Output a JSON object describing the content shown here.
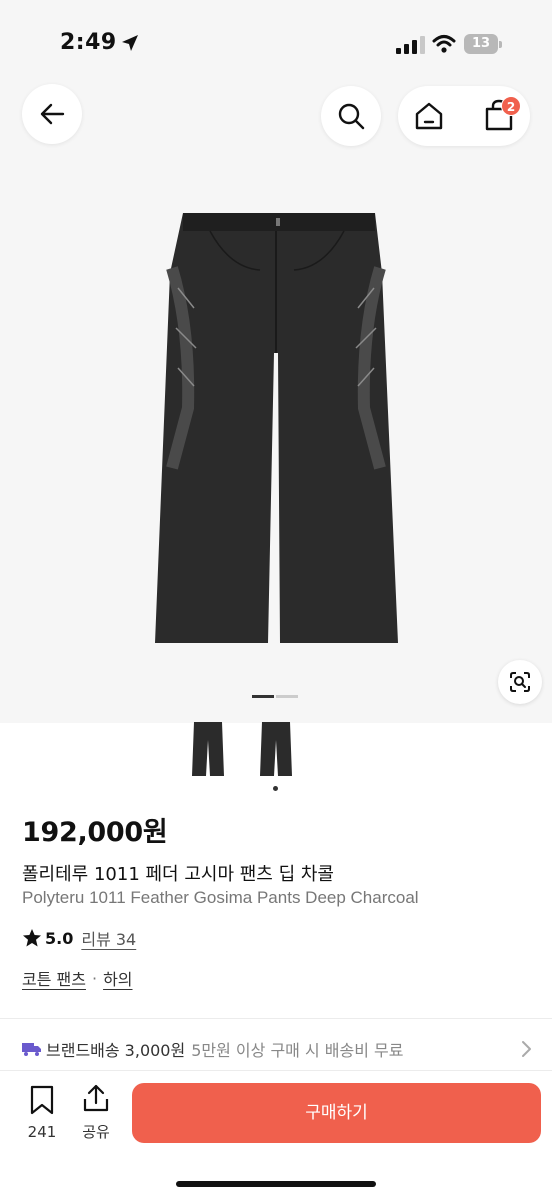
{
  "status_bar": {
    "time": "2:49",
    "battery": "13"
  },
  "header": {
    "cart_count": "2"
  },
  "gallery": {
    "page_index": 1,
    "page_count": 2
  },
  "product": {
    "price": "192,000원",
    "name_ko": "폴리테루 1011 페더 고시마 팬츠 딥 차콜",
    "name_en": "Polyteru 1011 Feather Gosima Pants Deep Charcoal",
    "rating": "5.0",
    "review_label": "리뷰 34",
    "category": "코튼 팬츠",
    "category_separator": "·",
    "category_parent": "하의"
  },
  "shipping": {
    "label": "브랜드배송 3,000원",
    "note": "5만원 이상 구매 시 배송비 무료"
  },
  "bottom_bar": {
    "like_count": "241",
    "share_label": "공유",
    "buy_label": "구매하기"
  },
  "colors": {
    "accent": "#f0604d",
    "truck": "#6a5acd",
    "backdrop": "#f6f6f6"
  }
}
